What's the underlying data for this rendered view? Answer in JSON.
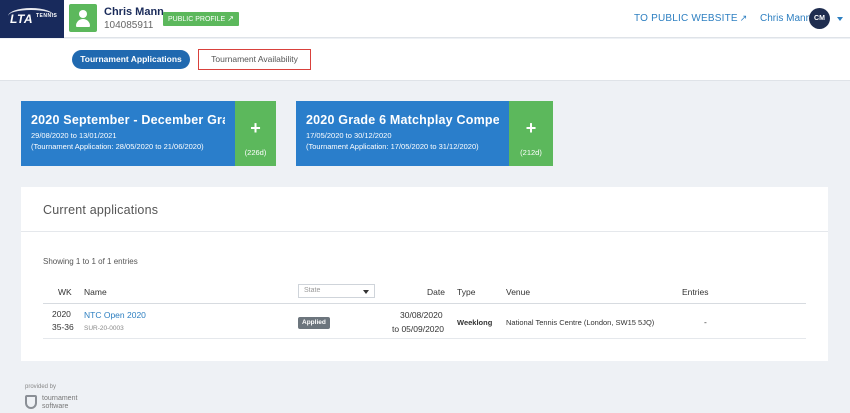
{
  "header": {
    "logo_text": "LTA",
    "logo_sub": "TENNIS",
    "user_name": "Chris Mann",
    "user_id": "104085911",
    "public_profile_label": "PUBLIC PROFILE",
    "to_public_website": "TO PUBLIC WEBSITE",
    "account_name": "Chris Mann",
    "account_initials": "CM"
  },
  "tabs": [
    {
      "label": "Tournament Applications",
      "active": true
    },
    {
      "label": "Tournament Availability",
      "active": false
    }
  ],
  "tournaments": [
    {
      "title": "2020 September - December Gra...",
      "dates": "29/08/2020 to 13/01/2021",
      "application": "(Tournament Application: 28/05/2020 to 21/06/2020)",
      "count": "(226d)"
    },
    {
      "title": "2020 Grade 6 Matchplay Competi...",
      "dates": "17/05/2020 to 30/12/2020",
      "application": "(Tournament Application: 17/05/2020 to 31/12/2020)",
      "count": "(212d)"
    }
  ],
  "applications": {
    "title": "Current applications",
    "showing": "Showing 1 to 1 of 1 entries",
    "columns": {
      "wk": "WK",
      "name": "Name",
      "state_placeholder": "State",
      "date": "Date",
      "type": "Type",
      "venue": "Venue",
      "entries": "Entries"
    },
    "rows": [
      {
        "year": "2020",
        "weeks": "35-36",
        "name": "NTC Open 2020",
        "code": "SUR-20-0003",
        "state": "Applied",
        "date_from": "30/08/2020",
        "date_to": "to 05/09/2020",
        "type": "Weeklong",
        "venue": "National Tennis Centre (London, SW15 5JQ)",
        "entries": "-"
      }
    ]
  },
  "footer": {
    "provided_by": "provided by",
    "brand_line1": "tournament",
    "brand_line2": "software"
  },
  "colors": {
    "primary_blue": "#2a7ecb",
    "navy": "#182a5c",
    "green": "#5cb85c",
    "link": "#2d7fc1",
    "highlight_red": "#d9413c"
  }
}
